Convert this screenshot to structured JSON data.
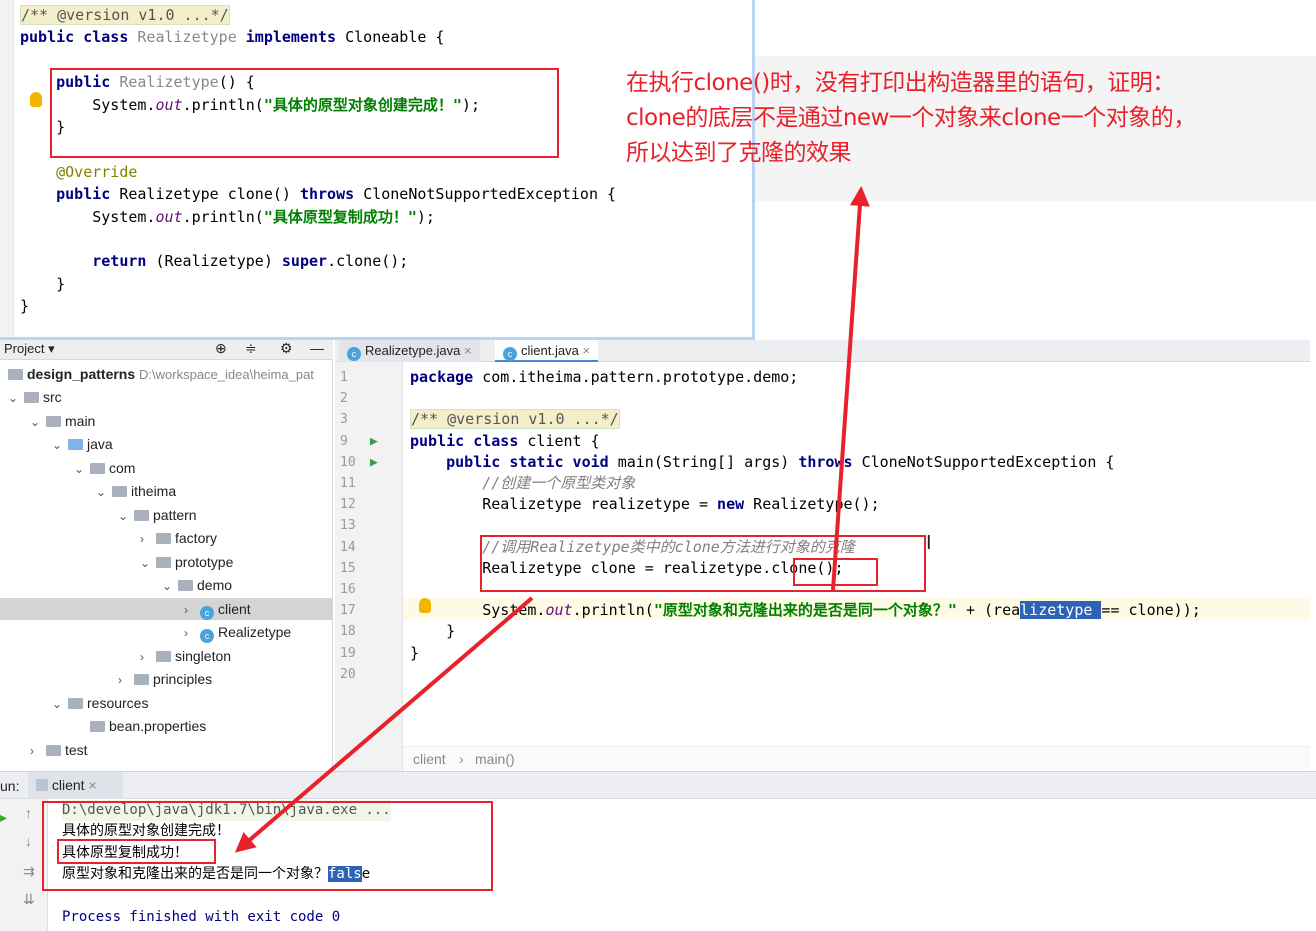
{
  "snippet": {
    "lines": [
      [
        {
          "t": "/** @version v1.0 ...*/",
          "c": "doc"
        }
      ],
      [
        {
          "t": "public class ",
          "c": "kw"
        },
        {
          "t": "Realizetype",
          "c": "dim"
        },
        {
          "t": " implements ",
          "c": "kw"
        },
        {
          "t": "Cloneable {",
          "c": ""
        }
      ],
      [],
      [
        {
          "t": "    public ",
          "c": "kw"
        },
        {
          "t": "Realizetype",
          "c": "dim"
        },
        {
          "t": "() {",
          "c": ""
        }
      ],
      [
        {
          "t": "        System.",
          "c": ""
        },
        {
          "t": "out",
          "c": "fld"
        },
        {
          "t": ".println(",
          "c": ""
        },
        {
          "t": "\"具体的原型对象创建完成！\"",
          "c": "str"
        },
        {
          "t": ");",
          "c": ""
        }
      ],
      [
        {
          "t": "    }",
          "c": ""
        }
      ],
      [],
      [
        {
          "t": "    @Override",
          "c": "ann"
        }
      ],
      [
        {
          "t": "    public ",
          "c": "kw"
        },
        {
          "t": "Realizetype clone() ",
          "c": ""
        },
        {
          "t": "throws ",
          "c": "kw"
        },
        {
          "t": "CloneNotSupportedException {",
          "c": ""
        }
      ],
      [
        {
          "t": "        System.",
          "c": ""
        },
        {
          "t": "out",
          "c": "fld"
        },
        {
          "t": ".println(",
          "c": ""
        },
        {
          "t": "\"具体原型复制成功！\"",
          "c": "str"
        },
        {
          "t": ");",
          "c": ""
        }
      ],
      [],
      [
        {
          "t": "        return ",
          "c": "kw"
        },
        {
          "t": "(Realizetype) ",
          "c": ""
        },
        {
          "t": "super",
          "c": "kw"
        },
        {
          "t": ".clone();",
          "c": ""
        }
      ],
      [
        {
          "t": "    }",
          "c": ""
        }
      ],
      [
        {
          "t": "}",
          "c": ""
        }
      ]
    ]
  },
  "annotation": {
    "lines": [
      "在执行clone()时，没有打印出构造器里的语句，证明：",
      "clone的底层不是通过new一个对象来clone一个对象的，",
      "所以达到了克隆的效果"
    ],
    "color": "#e8212b"
  },
  "project": {
    "title": "Project",
    "root": "design_patterns",
    "root_path": "D:\\workspace_idea\\heima_pat",
    "tree": [
      {
        "label": "src",
        "depth": 0,
        "open": true,
        "icon": "folder"
      },
      {
        "label": "main",
        "depth": 1,
        "open": true,
        "icon": "folder"
      },
      {
        "label": "java",
        "depth": 2,
        "open": true,
        "icon": "folder-blue"
      },
      {
        "label": "com",
        "depth": 3,
        "open": true,
        "icon": "package"
      },
      {
        "label": "itheima",
        "depth": 4,
        "open": true,
        "icon": "package"
      },
      {
        "label": "pattern",
        "depth": 5,
        "open": true,
        "icon": "package"
      },
      {
        "label": "factory",
        "depth": 6,
        "open": false,
        "icon": "package"
      },
      {
        "label": "prototype",
        "depth": 6,
        "open": true,
        "icon": "package"
      },
      {
        "label": "demo",
        "depth": 7,
        "open": true,
        "icon": "package"
      },
      {
        "label": "client",
        "depth": 8,
        "open": false,
        "icon": "class",
        "selected": true
      },
      {
        "label": "Realizetype",
        "depth": 8,
        "open": false,
        "icon": "class"
      },
      {
        "label": "singleton",
        "depth": 6,
        "open": false,
        "icon": "package"
      },
      {
        "label": "principles",
        "depth": 5,
        "open": false,
        "icon": "package"
      },
      {
        "label": "resources",
        "depth": 2,
        "open": true,
        "icon": "folder-resources"
      },
      {
        "label": "bean.properties",
        "depth": 3,
        "icon": "properties-file"
      },
      {
        "label": "test",
        "depth": 1,
        "open": false,
        "icon": "folder"
      }
    ]
  },
  "tabs": [
    {
      "label": "Realizetype.java",
      "active": false
    },
    {
      "label": "client.java",
      "active": true
    }
  ],
  "editor": {
    "lines": [
      {
        "n": "1",
        "tokens": [
          {
            "t": "package ",
            "c": "kw"
          },
          {
            "t": "com.itheima.pattern.prototype.demo;",
            "c": ""
          }
        ]
      },
      {
        "n": "2",
        "tokens": []
      },
      {
        "n": "3",
        "tokens": [
          {
            "t": "/** @version v1.0 ...*/",
            "c": "doc"
          }
        ]
      },
      {
        "n": "9",
        "run": true,
        "tokens": [
          {
            "t": "public class ",
            "c": "kw"
          },
          {
            "t": "client {",
            "c": ""
          }
        ]
      },
      {
        "n": "10",
        "run": true,
        "tokens": [
          {
            "t": "    public static void ",
            "c": "kw"
          },
          {
            "t": "main(String[] args) ",
            "c": ""
          },
          {
            "t": "throws ",
            "c": "kw"
          },
          {
            "t": "CloneNotSupportedException {",
            "c": ""
          }
        ]
      },
      {
        "n": "11",
        "tokens": [
          {
            "t": "        //创建一个原型类对象",
            "c": "cm"
          }
        ]
      },
      {
        "n": "12",
        "tokens": [
          {
            "t": "        Realizetype realizetype = ",
            "c": ""
          },
          {
            "t": "new ",
            "c": "kw"
          },
          {
            "t": "Realizetype();",
            "c": ""
          }
        ]
      },
      {
        "n": "13",
        "tokens": []
      },
      {
        "n": "14",
        "tokens": [
          {
            "t": "        //调用Realizetype类中的clone方法进行对象的克隆",
            "c": "cm"
          }
        ]
      },
      {
        "n": "15",
        "tokens": [
          {
            "t": "        Realizetype clone = realizetype.clone();",
            "c": ""
          }
        ]
      },
      {
        "n": "16",
        "tokens": []
      },
      {
        "n": "17",
        "tokens": [
          {
            "t": "        System.",
            "c": ""
          },
          {
            "t": "out",
            "c": "fld"
          },
          {
            "t": ".println(",
            "c": ""
          },
          {
            "t": "\"原型对象和克隆出来的是否是同一个对象？\"",
            "c": "str"
          },
          {
            "t": " + (rea",
            "c": ""
          },
          {
            "t": "lizetype ",
            "c": "sel"
          },
          {
            "t": "== clone));",
            "c": ""
          }
        ]
      },
      {
        "n": "18",
        "tokens": [
          {
            "t": "    }",
            "c": ""
          }
        ]
      },
      {
        "n": "19",
        "tokens": [
          {
            "t": "}",
            "c": ""
          }
        ]
      },
      {
        "n": "20",
        "tokens": []
      }
    ]
  },
  "breadcrumb": [
    "client",
    "main()"
  ],
  "run": {
    "label": "un:",
    "tab": "client",
    "output": [
      {
        "t": "D:\\develop\\java\\jdk1.7\\bin\\java.exe ...",
        "c": "cmd"
      },
      {
        "t": "具体的原型对象创建完成！",
        "c": ""
      },
      {
        "t": "具体原型复制成功！",
        "c": ""
      },
      {
        "t": "原型对象和克隆出来的是否是同一个对象？",
        "c": "",
        "sel": "fals",
        "tail": "e"
      },
      {
        "t": "",
        "c": ""
      },
      {
        "t": "Process finished with exit code 0",
        "c": "exit"
      }
    ]
  },
  "colors": {
    "highlight_box": "#e8212b",
    "keyword": "#000080",
    "string": "#008000",
    "selection": "#2e62b5"
  }
}
